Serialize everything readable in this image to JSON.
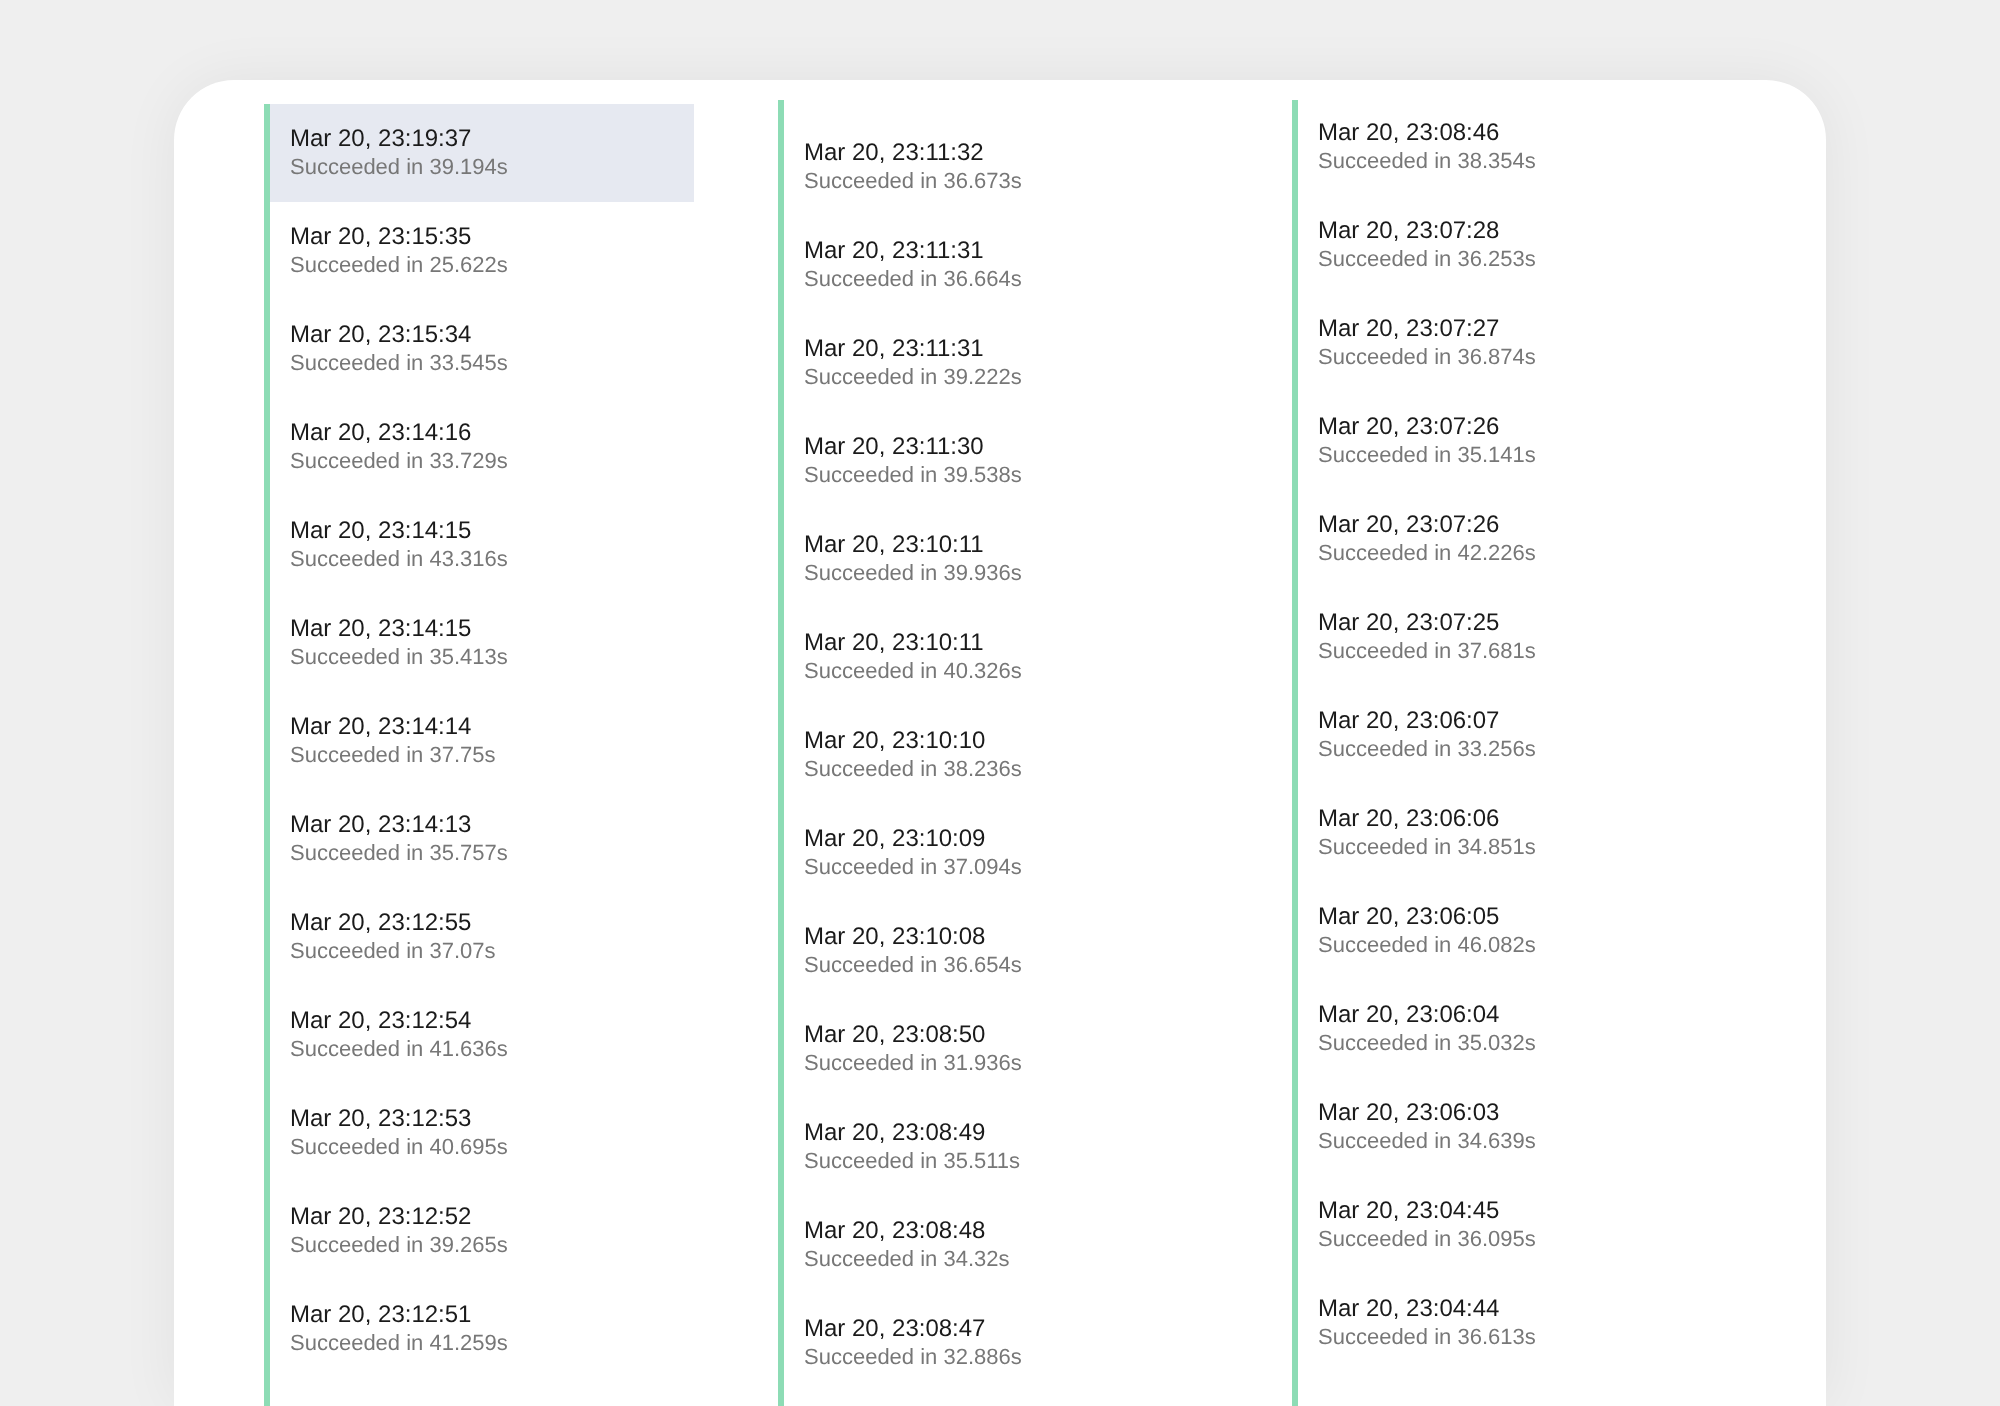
{
  "columns": [
    {
      "items": [
        {
          "time": "Mar 20, 23:19:37",
          "status": "Succeeded in 39.194s",
          "selected": true
        },
        {
          "time": "Mar 20, 23:15:35",
          "status": "Succeeded in 25.622s",
          "selected": false
        },
        {
          "time": "Mar 20, 23:15:34",
          "status": "Succeeded in 33.545s",
          "selected": false
        },
        {
          "time": "Mar 20, 23:14:16",
          "status": "Succeeded in 33.729s",
          "selected": false
        },
        {
          "time": "Mar 20, 23:14:15",
          "status": "Succeeded in 43.316s",
          "selected": false
        },
        {
          "time": "Mar 20, 23:14:15",
          "status": "Succeeded in 35.413s",
          "selected": false
        },
        {
          "time": "Mar 20, 23:14:14",
          "status": "Succeeded in 37.75s",
          "selected": false
        },
        {
          "time": "Mar 20, 23:14:13",
          "status": "Succeeded in 35.757s",
          "selected": false
        },
        {
          "time": "Mar 20, 23:12:55",
          "status": "Succeeded in 37.07s",
          "selected": false
        },
        {
          "time": "Mar 20, 23:12:54",
          "status": "Succeeded in 41.636s",
          "selected": false
        },
        {
          "time": "Mar 20, 23:12:53",
          "status": "Succeeded in 40.695s",
          "selected": false
        },
        {
          "time": "Mar 20, 23:12:52",
          "status": "Succeeded in 39.265s",
          "selected": false
        },
        {
          "time": "Mar 20, 23:12:51",
          "status": "Succeeded in 41.259s",
          "selected": false
        }
      ]
    },
    {
      "items": [
        {
          "time": "Mar 20, 23:11:32",
          "status": "Succeeded in 36.673s",
          "selected": false
        },
        {
          "time": "Mar 20, 23:11:31",
          "status": "Succeeded in 36.664s",
          "selected": false
        },
        {
          "time": "Mar 20, 23:11:31",
          "status": "Succeeded in 39.222s",
          "selected": false
        },
        {
          "time": "Mar 20, 23:11:30",
          "status": "Succeeded in 39.538s",
          "selected": false
        },
        {
          "time": "Mar 20, 23:10:11",
          "status": "Succeeded in 39.936s",
          "selected": false
        },
        {
          "time": "Mar 20, 23:10:11",
          "status": "Succeeded in 40.326s",
          "selected": false
        },
        {
          "time": "Mar 20, 23:10:10",
          "status": "Succeeded in 38.236s",
          "selected": false
        },
        {
          "time": "Mar 20, 23:10:09",
          "status": "Succeeded in 37.094s",
          "selected": false
        },
        {
          "time": "Mar 20, 23:10:08",
          "status": "Succeeded in 36.654s",
          "selected": false
        },
        {
          "time": "Mar 20, 23:08:50",
          "status": "Succeeded in 31.936s",
          "selected": false
        },
        {
          "time": "Mar 20, 23:08:49",
          "status": "Succeeded in 35.511s",
          "selected": false
        },
        {
          "time": "Mar 20, 23:08:48",
          "status": "Succeeded in 34.32s",
          "selected": false
        },
        {
          "time": "Mar 20, 23:08:47",
          "status": "Succeeded in 32.886s",
          "selected": false
        }
      ]
    },
    {
      "items": [
        {
          "time": "Mar 20, 23:08:46",
          "status": "Succeeded in 38.354s",
          "selected": false
        },
        {
          "time": "Mar 20, 23:07:28",
          "status": "Succeeded in 36.253s",
          "selected": false
        },
        {
          "time": "Mar 20, 23:07:27",
          "status": "Succeeded in 36.874s",
          "selected": false
        },
        {
          "time": "Mar 20, 23:07:26",
          "status": "Succeeded in 35.141s",
          "selected": false
        },
        {
          "time": "Mar 20, 23:07:26",
          "status": "Succeeded in 42.226s",
          "selected": false
        },
        {
          "time": "Mar 20, 23:07:25",
          "status": "Succeeded in 37.681s",
          "selected": false
        },
        {
          "time": "Mar 20, 23:06:07",
          "status": "Succeeded in 33.256s",
          "selected": false
        },
        {
          "time": "Mar 20, 23:06:06",
          "status": "Succeeded in 34.851s",
          "selected": false
        },
        {
          "time": "Mar 20, 23:06:05",
          "status": "Succeeded in 46.082s",
          "selected": false
        },
        {
          "time": "Mar 20, 23:06:04",
          "status": "Succeeded in 35.032s",
          "selected": false
        },
        {
          "time": "Mar 20, 23:06:03",
          "status": "Succeeded in 34.639s",
          "selected": false
        },
        {
          "time": "Mar 20, 23:04:45",
          "status": "Succeeded in 36.095s",
          "selected": false
        },
        {
          "time": "Mar 20, 23:04:44",
          "status": "Succeeded in 36.613s",
          "selected": false
        }
      ]
    }
  ]
}
